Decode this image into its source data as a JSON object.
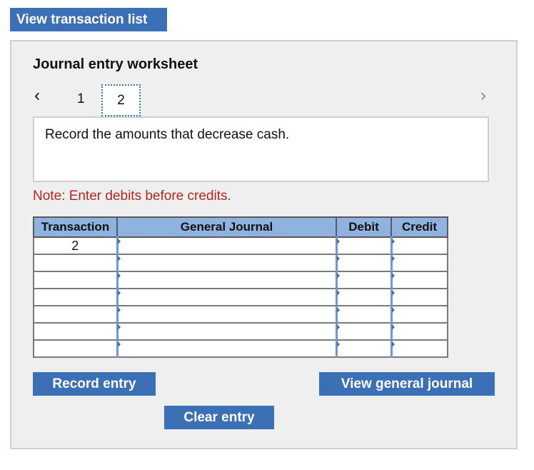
{
  "header": {
    "view_transaction_list": "View transaction list"
  },
  "worksheet": {
    "title": "Journal entry worksheet",
    "pages": [
      "1",
      "2"
    ],
    "current_page": "2",
    "instruction": "Record the amounts that decrease cash.",
    "note": "Note: Enter debits before credits."
  },
  "table": {
    "headers": [
      "Transaction",
      "General Journal",
      "Debit",
      "Credit"
    ],
    "first_transaction": "2",
    "row_count": 7
  },
  "buttons": {
    "record_entry": "Record entry",
    "view_general_journal": "View general journal",
    "clear_entry": "Clear entry"
  },
  "colors": {
    "accent": "#3b6fb6",
    "header_bg": "#8fb2df",
    "note": "#b3261e"
  },
  "icons": {
    "prev": "chevron-left-icon",
    "next": "chevron-right-icon"
  }
}
